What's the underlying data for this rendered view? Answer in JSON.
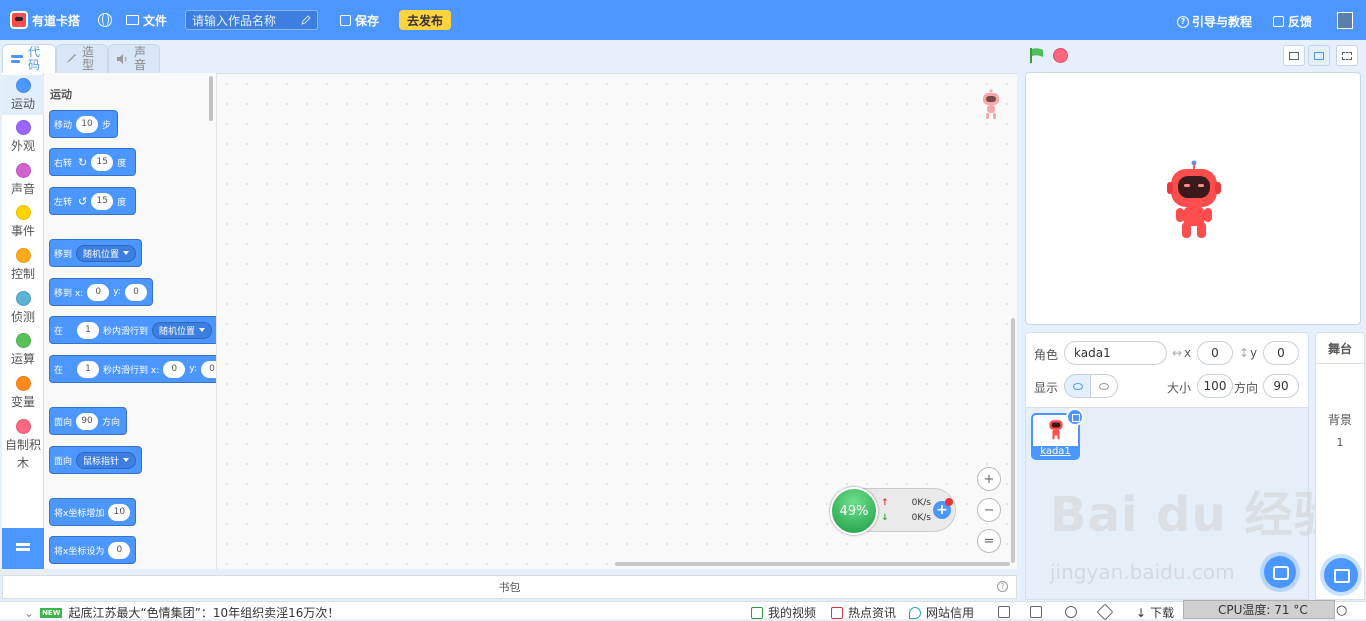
{
  "topbar": {
    "app_name": "有道卡搭",
    "file_label": "文件",
    "name_placeholder": "请输入作品名称",
    "save_label": "保存",
    "publish_label": "去发布",
    "guide_label": "引导与教程",
    "feedback_label": "反馈"
  },
  "tabs": [
    {
      "label": "代码",
      "icon": "code-icon"
    },
    {
      "label": "造型",
      "icon": "brush-icon"
    },
    {
      "label": "声音",
      "icon": "speaker-icon"
    }
  ],
  "categories": [
    {
      "label": "运动",
      "color": "#4c97ff"
    },
    {
      "label": "外观",
      "color": "#9966ff"
    },
    {
      "label": "声音",
      "color": "#cf63cf"
    },
    {
      "label": "事件",
      "color": "#ffd500"
    },
    {
      "label": "控制",
      "color": "#ffab19"
    },
    {
      "label": "侦测",
      "color": "#5cb1d6"
    },
    {
      "label": "运算",
      "color": "#59c059"
    },
    {
      "label": "变量",
      "color": "#ff8c1a"
    },
    {
      "label": "自制积木",
      "color": "#ff6680"
    }
  ],
  "palette": {
    "title": "运动",
    "blocks": {
      "move": {
        "pre": "移动",
        "value": "10",
        "post": "步"
      },
      "turn_right": {
        "pre": "右转",
        "icon": "↻",
        "value": "15",
        "post": "度"
      },
      "turn_left": {
        "pre": "左转",
        "icon": "↺",
        "value": "15",
        "post": "度"
      },
      "goto": {
        "pre": "移到",
        "option": "随机位置"
      },
      "goto_xy": {
        "pre": "移到 x:",
        "x": "0",
        "ylabel": "y:",
        "y": "0"
      },
      "glide": {
        "pre": "在",
        "value": "1",
        "mid": "秒内滑行到",
        "option": "随机位置"
      },
      "glide_xy": {
        "pre": "在",
        "value": "1",
        "mid": "秒内滑行到 x:",
        "x": "0",
        "ylabel": "y:",
        "y": "0"
      },
      "point": {
        "pre": "面向",
        "value": "90",
        "post": "方向"
      },
      "point_towards": {
        "pre": "面向",
        "option": "鼠标指针"
      },
      "change_x": {
        "pre": "将x坐标增加",
        "value": "10"
      },
      "set_x": {
        "pre": "将x坐标设为",
        "value": "0"
      }
    }
  },
  "backpack_label": "书包",
  "sprite_info": {
    "sprite_label": "角色",
    "sprite_name": "kada1",
    "x_label": "x",
    "x_value": "0",
    "y_label": "y",
    "y_value": "0",
    "show_label": "显示",
    "size_label": "大小",
    "size_value": "100",
    "direction_label": "方向",
    "direction_value": "90"
  },
  "sprite_tile_name": "kada1",
  "stage_panel": {
    "title": "舞台",
    "backdrop_label": "背景",
    "backdrop_count": "1"
  },
  "network_widget": {
    "percent": "49%",
    "up_speed": "0K/s",
    "down_speed": "0K/s"
  },
  "watermark": {
    "line1": "Bai du 经验",
    "line2": "jingyan.baidu.com"
  },
  "statusbar": {
    "news_badge": "NEW",
    "news_text": "起底江苏最大“色情集团”：10年组织卖淫16万次！",
    "my_video": "我的视频",
    "hot_news": "热点资讯",
    "credit": "网站信用",
    "download": "下载",
    "cpu_temp": "CPU温度: 71 °C"
  },
  "colors": {
    "accent": "#4c97ff",
    "publish_bg": "#ffd23f",
    "motion_block": "#4c97ff",
    "stop": "#ff6680"
  }
}
